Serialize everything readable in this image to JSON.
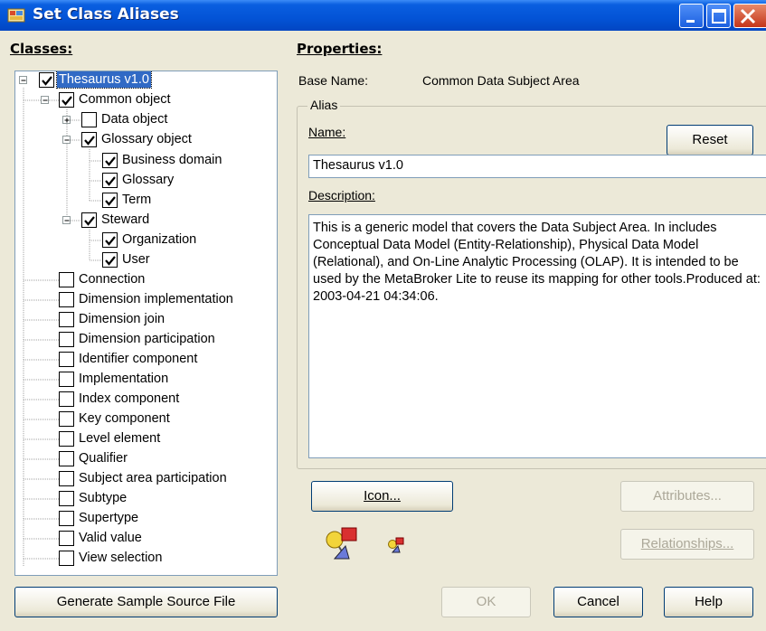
{
  "window": {
    "title": "Set Class Aliases"
  },
  "classes_label": "Classes:",
  "properties_label": "Properties:",
  "base_name": {
    "label": "Base Name:",
    "value": "Common Data Subject Area"
  },
  "alias": {
    "group_label": "Alias",
    "name_label": "Name:",
    "name_value": "Thesaurus v1.0",
    "reset_label": "Reset",
    "description_label": "Description:",
    "description_value": "This is a generic model that covers the Data Subject Area. In includes Conceptual Data Model (Entity-Relationship), Physical Data Model (Relational), and On-Line Analytic Processing (OLAP).  It is intended to be used by the MetaBroker Lite to reuse its mapping for other tools.Produced at: 2003-04-21 04:34:06."
  },
  "tree": [
    {
      "label": "Thesaurus v1.0",
      "checked": true,
      "expander": "minus",
      "selected": true
    },
    {
      "label": "Common object",
      "checked": true,
      "expander": "minus"
    },
    {
      "label": "Data object",
      "checked": false,
      "expander": "plus"
    },
    {
      "label": "Glossary object",
      "checked": true,
      "expander": "minus"
    },
    {
      "label": "Business domain",
      "checked": true
    },
    {
      "label": "Glossary",
      "checked": true
    },
    {
      "label": "Term",
      "checked": true
    },
    {
      "label": "Steward",
      "checked": true,
      "expander": "minus"
    },
    {
      "label": "Organization",
      "checked": true
    },
    {
      "label": "User",
      "checked": true
    },
    {
      "label": "Connection",
      "checked": false
    },
    {
      "label": "Dimension implementation",
      "checked": false
    },
    {
      "label": "Dimension join",
      "checked": false
    },
    {
      "label": "Dimension participation",
      "checked": false
    },
    {
      "label": "Identifier component",
      "checked": false
    },
    {
      "label": "Implementation",
      "checked": false
    },
    {
      "label": "Index component",
      "checked": false
    },
    {
      "label": "Key component",
      "checked": false
    },
    {
      "label": "Level element",
      "checked": false
    },
    {
      "label": "Qualifier",
      "checked": false
    },
    {
      "label": "Subject area participation",
      "checked": false
    },
    {
      "label": "Subtype",
      "checked": false
    },
    {
      "label": "Supertype",
      "checked": false
    },
    {
      "label": "Valid value",
      "checked": false
    },
    {
      "label": "View selection",
      "checked": false
    }
  ],
  "buttons": {
    "icon": "Icon...",
    "attributes": "Attributes...",
    "relationships": "Relationships...",
    "generate": "Generate Sample Source File",
    "ok": "OK",
    "cancel": "Cancel",
    "help": "Help"
  },
  "icons": {
    "app": "class-aliases-app-icon",
    "large_preview": "class-large-icon",
    "small_preview": "class-small-icon"
  },
  "colors": {
    "titlebar": "#0353d6",
    "selection": "#316ac5",
    "dialog_bg": "#ece9d8",
    "close_button": "#c4351a"
  }
}
